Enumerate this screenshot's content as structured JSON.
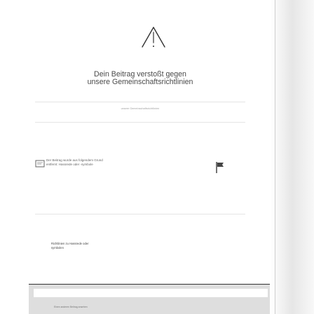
{
  "post": {
    "headline_line1": "Dein Beitrag verstoßt gegen",
    "headline_line2": "unsere Gemeinschaftsrichtlinien",
    "faint_text": "unsere Gemeinschaftsrichtlinien",
    "report_line1": "Der Beitrag wurde aus folgendem Grund",
    "report_line2": "entfernt: Hassrede oder -symbole",
    "guideline_line1": "Richtlinien zu Hassrede oder",
    "guideline_line2": "symbolen",
    "panel_text": "Einen anderen Beitrag ansehen"
  },
  "icons": {
    "warning": "warning-triangle-icon",
    "report": "message-icon",
    "flag": "flag-icon"
  },
  "colors": {
    "text": "#4a4a4a",
    "panel": "#dedede"
  }
}
